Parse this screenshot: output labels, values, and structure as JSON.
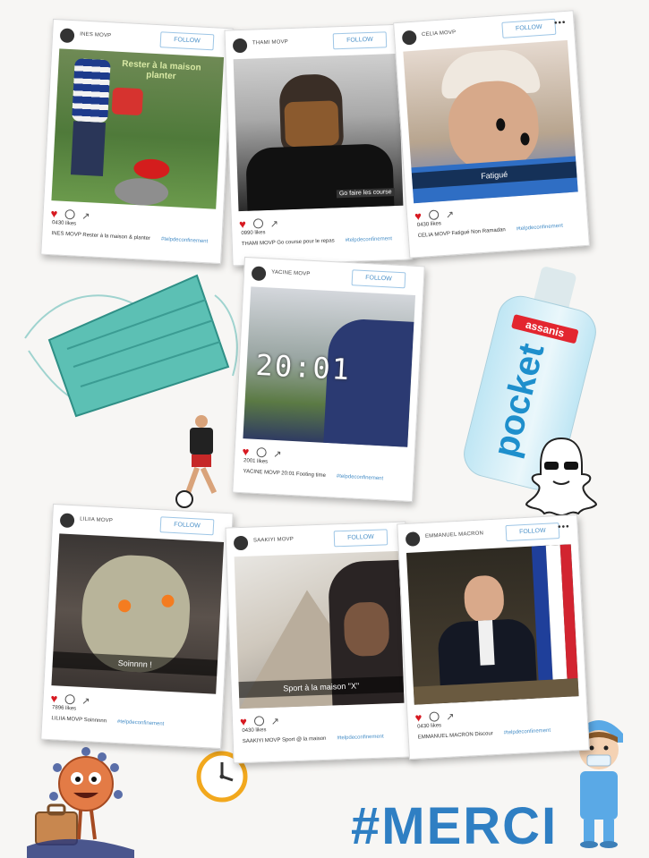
{
  "follow_label": "FOLLOW",
  "merci": "#MERCI",
  "posts": [
    {
      "user": "INES MOVP",
      "likes": "0430 likes",
      "caption": "INES MOVP Rester à la maison & planter",
      "hashtag": "#telpdeconfinement",
      "overlay": "Rester à la maison planter"
    },
    {
      "user": "THAMI MOVP",
      "likes": "0990 likes",
      "caption": "THAMI MOVP Go course pour le repas",
      "hashtag": "#telpdeconfinement",
      "overlay": "Go faire les course"
    },
    {
      "user": "CELIA MOVP",
      "likes": "0430 likes",
      "caption": "CELIA MOVP Fatigué Non Ramadan",
      "hashtag": "#telpdeconfinement",
      "overlay": "Fatigué"
    },
    {
      "user": "YACINE MOVP",
      "likes": "2001 likes",
      "caption": "YACINE MOVP 20:01 Footing time",
      "hashtag": "#telpdeconfinement",
      "overlay": "20:01"
    },
    {
      "user": "LILIIA MOVP",
      "likes": "7896 likes",
      "caption": "LILIIA MOVP Soinnnnn",
      "hashtag": "#telpdeconfinement",
      "overlay": "Soinnnn !"
    },
    {
      "user": "SAAKIYI MOVP",
      "likes": "0430 likes",
      "caption": "SAAKIYI MOVP Sport @ la maison",
      "hashtag": "#telpdeconfinement",
      "overlay": "Sport à la maison \"X\""
    },
    {
      "user": "EMMANUEL MACRON",
      "likes": "0430 likes",
      "caption": "EMMANUEL MACRON Discour",
      "hashtag": "#telpdeconfinement",
      "overlay": ""
    }
  ],
  "sanitizer": {
    "brand": "assanis",
    "name": "pocket"
  },
  "colors": {
    "accent": "#2f7fc3",
    "like": "#d71921",
    "mask": "#5cc0b4"
  }
}
